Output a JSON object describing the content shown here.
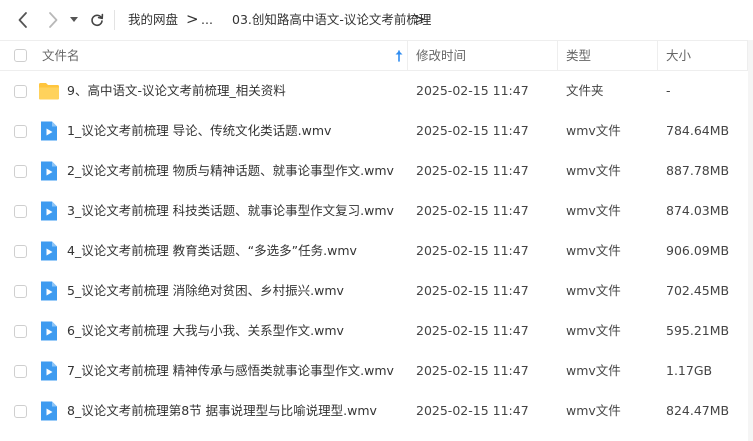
{
  "nav": {
    "breadcrumbs": [
      "我的网盘",
      "...",
      "03.创知路高中语文-议论文考前梳理"
    ]
  },
  "columns": {
    "name": "文件名",
    "modified": "修改时间",
    "type": "类型",
    "size": "大小"
  },
  "files": [
    {
      "name": "9、高中语文-议论文考前梳理_相关资料",
      "time": "2025-02-15 11:47",
      "type": "文件夹",
      "size": "-",
      "icon": "folder-icon"
    },
    {
      "name": "1_议论文考前梳理 导论、传统文化类话题.wmv",
      "time": "2025-02-15 11:47",
      "type": "wmv文件",
      "size": "784.64MB",
      "icon": "video-file-icon"
    },
    {
      "name": "2_议论文考前梳理 物质与精神话题、就事论事型作文.wmv",
      "time": "2025-02-15 11:47",
      "type": "wmv文件",
      "size": "887.78MB",
      "icon": "video-file-icon"
    },
    {
      "name": "3_议论文考前梳理 科技类话题、就事论事型作文复习.wmv",
      "time": "2025-02-15 11:47",
      "type": "wmv文件",
      "size": "874.03MB",
      "icon": "video-file-icon"
    },
    {
      "name": "4_议论文考前梳理 教育类话题、“多选多”任务.wmv",
      "time": "2025-02-15 11:47",
      "type": "wmv文件",
      "size": "906.09MB",
      "icon": "video-file-icon"
    },
    {
      "name": "5_议论文考前梳理 消除绝对贫困、乡村振兴.wmv",
      "time": "2025-02-15 11:47",
      "type": "wmv文件",
      "size": "702.45MB",
      "icon": "video-file-icon"
    },
    {
      "name": "6_议论文考前梳理 大我与小我、关系型作文.wmv",
      "time": "2025-02-15 11:47",
      "type": "wmv文件",
      "size": "595.21MB",
      "icon": "video-file-icon"
    },
    {
      "name": "7_议论文考前梳理 精神传承与感悟类就事论事型作文.wmv",
      "time": "2025-02-15 11:47",
      "type": "wmv文件",
      "size": "1.17GB",
      "icon": "video-file-icon"
    },
    {
      "name": "8_议论文考前梳理第8节 据事说理型与比喻说理型.wmv",
      "time": "2025-02-15 11:47",
      "type": "wmv文件",
      "size": "824.47MB",
      "icon": "video-file-icon"
    }
  ],
  "colors": {
    "folder": "#FFC53D",
    "video": "#3E9BF0",
    "sort_arrow": "#2F8CF0"
  }
}
